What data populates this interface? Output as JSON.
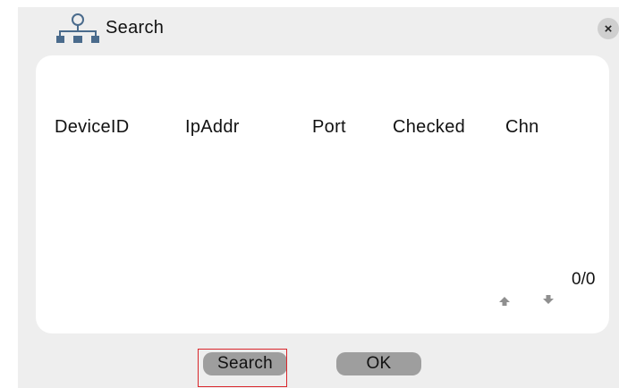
{
  "dialog": {
    "title": "Search",
    "title_icon": "network-topology-icon",
    "close_label": "×"
  },
  "table": {
    "columns": [
      "DeviceID",
      "IpAddr",
      "Port",
      "Checked",
      "Chn"
    ],
    "rows": []
  },
  "pager": {
    "text": "0/0",
    "up_icon": "arrow-up-icon",
    "down_icon": "arrow-down-icon"
  },
  "buttons": {
    "search_label": "Search",
    "ok_label": "OK"
  },
  "colors": {
    "dialog_bg": "#eeeeee",
    "panel_bg": "#ffffff",
    "icon_blue": "#4a6b8c",
    "button_bg": "#9e9e9e",
    "focus_border": "#d9262b"
  }
}
